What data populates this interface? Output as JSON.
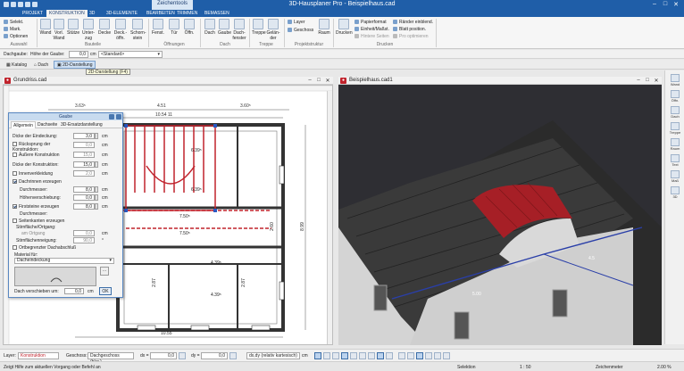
{
  "window": {
    "title": "3D-Hausplaner Pro - Beispielhaus.cad",
    "context_tab": "Zeichentools",
    "minimize": "–",
    "maximize": "□",
    "close": "✕"
  },
  "tabs": [
    "PROJEKT",
    "KONSTRUKTION",
    "3D",
    "3D-ELEMENTE",
    "BEARBEITEN",
    "TRIMMEN",
    "BEMASSEN"
  ],
  "ribbon": {
    "auswahl": {
      "select": "Selekt.",
      "mark": "Mark.",
      "options": "Optionen",
      "group": "Auswahl"
    },
    "bauteile": {
      "items": [
        "Wand",
        "Vorl. Wand",
        "Stütze",
        "Unter-zug",
        "Decke",
        "Deck.-öffn.",
        "Schorn-stein"
      ],
      "group": "Bauteile"
    },
    "oeffnungen": {
      "items": [
        "Fenst.",
        "Tür",
        "Öffn."
      ],
      "group": "Öffnungen"
    },
    "dach": {
      "items": [
        "Dach",
        "Gaube",
        "Dach-fenster"
      ],
      "group": "Dach"
    },
    "treppe": {
      "items": [
        "Treppe",
        "Gelän-der"
      ],
      "group": "Treppe"
    },
    "projektstruktur": {
      "layer": "Layer",
      "geschoss": "Geschoss",
      "raum": "Raum",
      "group": "Projektstruktur"
    },
    "drucken": {
      "drucken": "Drucken",
      "papierformat": "Papierformat",
      "einheit": "Einheit/Maßst.",
      "hintere": "Hintere Seiten",
      "raender": "Ränder einblend.",
      "blatt": "Blatt position.",
      "pro": "Pro optimieren",
      "group": "Drucken"
    }
  },
  "optbar": {
    "label1": "Dachgaube:",
    "label2": "Höhe der Gaube:",
    "value": "0,0",
    "unit": "cm",
    "style": "<Standard>"
  },
  "viewbar": {
    "katalog": "Katalog",
    "dach": "Dach",
    "darstellung": "2D-Darstellung",
    "tooltip": "2D-Darstellung (F4)"
  },
  "plan": {
    "title": "Grundriss.cad",
    "dims": {
      "top1": "3.63⁵",
      "top2": "4.51",
      "top3": "3.60⁵",
      "top4": "10.54 11",
      "room1": "6.39⁵",
      "room2": "6.39⁵",
      "room3": "7.50⁵",
      "room4": "7.50⁵",
      "room5": "4.39⁵",
      "room6": "4.39⁵",
      "side1": "2.60",
      "side2": "8.99",
      "side3": "2.87",
      "side4": "2.87",
      "bottom": "10.55"
    }
  },
  "view3d": {
    "title": "Beispielhaus.cad1",
    "dim_a": "5.00",
    "dim_b": "4.5"
  },
  "dialog": {
    "title": "Gaube",
    "tabs": [
      "Allgemein",
      "Dachseite",
      "3D-Ersatzdarstellung"
    ],
    "dicke_eindeckung": {
      "label": "Dicke der Eindeckung:",
      "value": "3,0",
      "unit": "cm"
    },
    "ruecksprung": {
      "label": "Rücksprung der Konstruktion:",
      "value": "0,0",
      "unit": "cm",
      "checked": false
    },
    "aussere": {
      "label": "Äußere Konstruktion",
      "value": "15,0",
      "unit": "cm",
      "checked": false
    },
    "dicke_konstruktion": {
      "label": "Dicke der Konstruktion:",
      "value": "15,0",
      "unit": "cm"
    },
    "innenverkleidung": {
      "label": "Innenverkleidung",
      "value": "2,0",
      "unit": "cm",
      "checked": false
    },
    "dachrinnen": {
      "label": "Dachrinnen erzeugen",
      "checked": true
    },
    "durchmesser1": {
      "label": "Durchmesser:",
      "value": "8,0",
      "unit": "cm"
    },
    "hoehenverschiebung": {
      "label": "Höhenverschiebung:",
      "value": "0,0",
      "unit": "cm"
    },
    "firststeine": {
      "label": "Firststeine erzeugen",
      "checked": true
    },
    "durchmesser2": {
      "label": "Durchmesser:",
      "value": "8,0",
      "unit": "cm"
    },
    "seitenkanten": {
      "label": "Seitenkanten erzeugen",
      "checked": false
    },
    "ortgang_label": "Stirnfläche/Ortgang:",
    "orttgang": {
      "label": "am Ortgang",
      "value": "0,0",
      "unit": "cm"
    },
    "stirnflaechen": {
      "label": "Stirnflächenneigung:",
      "value": "90,0",
      "unit": "°"
    },
    "ortbegrenzter": {
      "label": "Ortbegrenzter Dachabschluß",
      "checked": false
    },
    "material_label": "Material für:",
    "material_value": "Dacheindeckung",
    "verschieben": {
      "label": "Dach verschieben um:",
      "value": "0,0",
      "unit": "cm"
    },
    "ok": "OK"
  },
  "dock": [
    "Wand",
    "Öffn.",
    "Dach",
    "Treppe",
    "Raum",
    "Text",
    "Maß",
    "3D"
  ],
  "status": {
    "layer_label": "Layer:",
    "layer_value": "Konstruktion",
    "geschoss_label": "Geschoss:",
    "geschoss_value": "Dachgeschoss (bkg.)",
    "dx_label": "dx =",
    "dx_value": "0,0",
    "dy_label": "dy =",
    "dy_value": "0,0",
    "mode": "dx,dy (relativ kartesisch)",
    "unit_label": "cm",
    "selection": "Selektion",
    "scale": "1 : 50",
    "zeichenmodus": "Zeichenmeter",
    "zoom": "2.00 %",
    "hint": "Zeigt Hilfe zum aktuellen Vorgang oder Befehl an"
  },
  "colors": {
    "titlebar": "#1f5ea8",
    "accent": "#c0232c",
    "roof": "#3a3a3a",
    "grass": "#4e8a2a",
    "sky": "#2e2e33"
  }
}
